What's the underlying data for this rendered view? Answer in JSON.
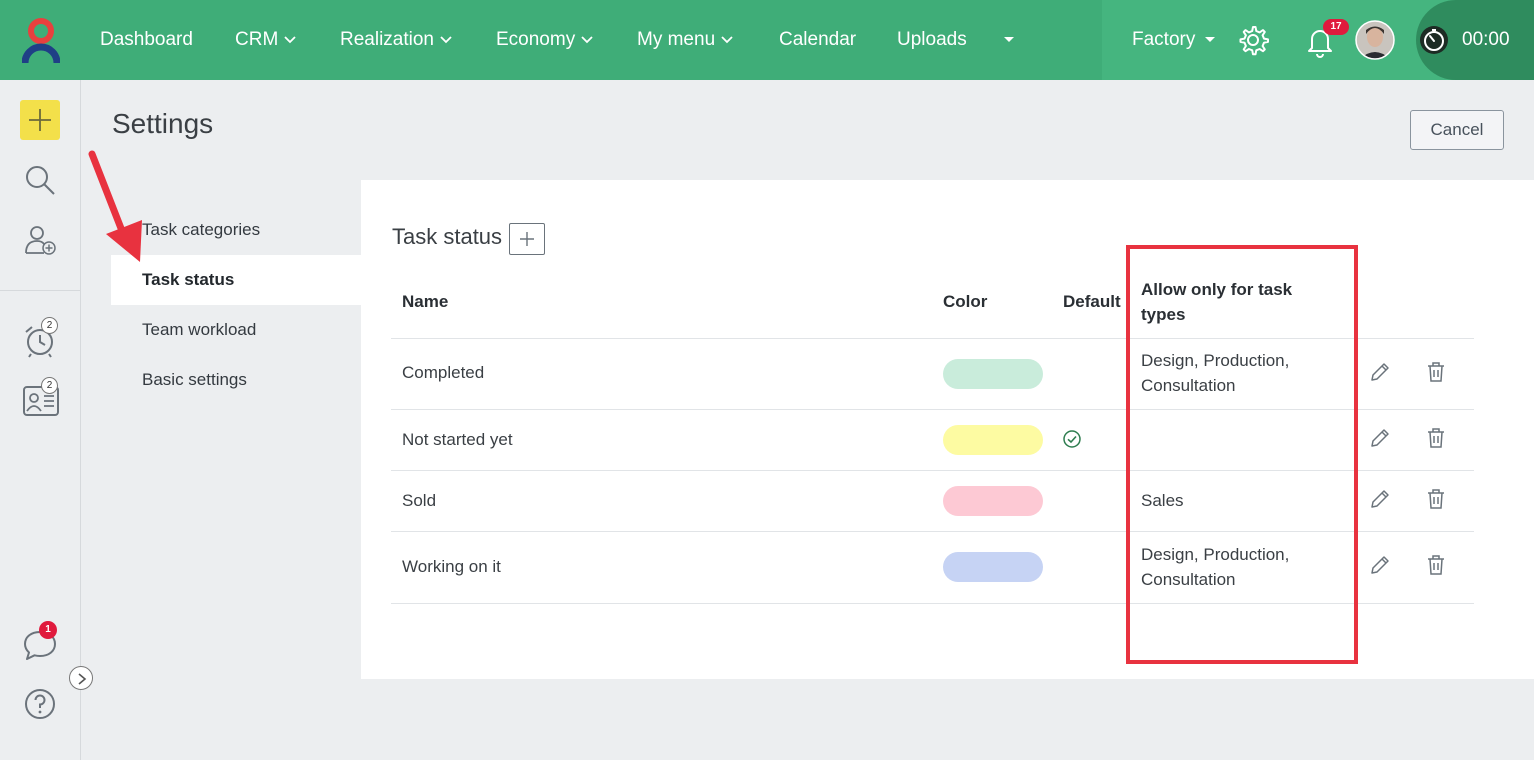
{
  "topbar": {
    "nav": [
      {
        "label": "Dashboard",
        "has_dropdown": false
      },
      {
        "label": "CRM",
        "has_dropdown": true
      },
      {
        "label": "Realization",
        "has_dropdown": true
      },
      {
        "label": "Economy",
        "has_dropdown": true
      },
      {
        "label": "My menu",
        "has_dropdown": true
      },
      {
        "label": "Calendar",
        "has_dropdown": false
      },
      {
        "label": "Uploads",
        "has_dropdown": false
      }
    ],
    "company": "Factory",
    "notifications_count": "17",
    "timer": "00:00",
    "colors": {
      "bar": "#3fad78",
      "timer_zone": "#2f8c5e",
      "badge": "#e01a3d"
    }
  },
  "rail": {
    "reminders_count": "2",
    "contacts_count": "2",
    "chat_count": "1"
  },
  "page": {
    "title": "Settings",
    "cancel_label": "Cancel"
  },
  "submenu": [
    {
      "label": "Task categories",
      "active": false
    },
    {
      "label": "Task status",
      "active": true
    },
    {
      "label": "Team workload",
      "active": false
    },
    {
      "label": "Basic settings",
      "active": false
    }
  ],
  "task_status": {
    "title": "Task status",
    "columns": {
      "name": "Name",
      "color": "Color",
      "default": "Default",
      "allow": "Allow only for task types"
    },
    "rows": [
      {
        "name": "Completed",
        "color": "#c9ecdb",
        "default": false,
        "allow": "Design, Production, Consultation"
      },
      {
        "name": "Not started yet",
        "color": "#fdfba2",
        "default": true,
        "allow": ""
      },
      {
        "name": "Sold",
        "color": "#fdc9d4",
        "default": false,
        "allow": "Sales"
      },
      {
        "name": "Working on it",
        "color": "#c6d3f4",
        "default": false,
        "allow": "Design, Production, Consultation"
      }
    ]
  }
}
